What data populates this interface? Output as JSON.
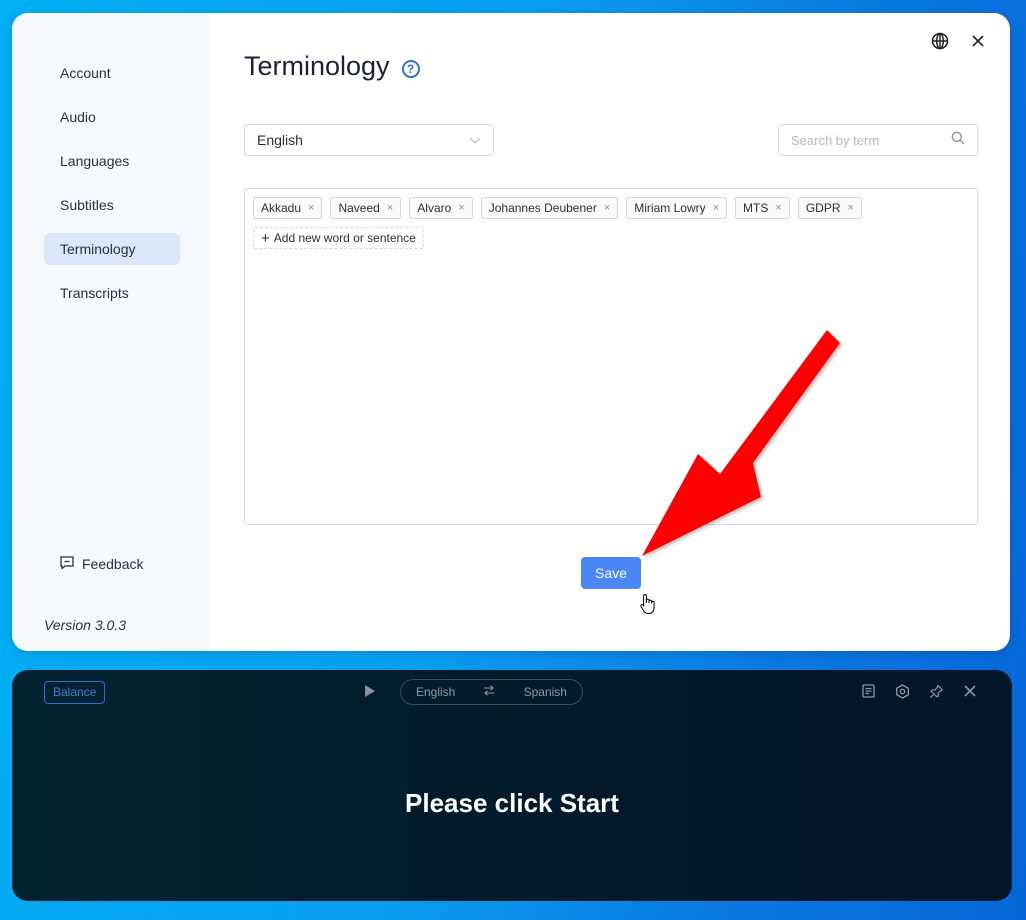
{
  "settings": {
    "title": "Terminology",
    "sidebar": {
      "items": [
        {
          "label": "Account",
          "active": false
        },
        {
          "label": "Audio",
          "active": false
        },
        {
          "label": "Languages",
          "active": false
        },
        {
          "label": "Subtitles",
          "active": false
        },
        {
          "label": "Terminology",
          "active": true
        },
        {
          "label": "Transcripts",
          "active": false
        }
      ],
      "feedback_label": "Feedback",
      "version": "Version 3.0.3"
    },
    "language_select": {
      "value": "English"
    },
    "search": {
      "placeholder": "Search by term",
      "value": ""
    },
    "terms": [
      "Akkadu",
      "Naveed",
      "Alvaro",
      "Johannes Deubener",
      "Miriam Lowry",
      "MTS",
      "GDPR"
    ],
    "add_term_label": "Add new word or sentence",
    "save_label": "Save",
    "icons": {
      "help": "?",
      "tag_close": "×",
      "add": "+"
    }
  },
  "overlay": {
    "balance_label": "Balance",
    "source_language": "English",
    "target_language": "Spanish",
    "prompt": "Please click Start"
  },
  "colors": {
    "accent": "#4b86f6",
    "annotation_arrow": "#ff0000",
    "overlay_bg": "#03222f"
  }
}
